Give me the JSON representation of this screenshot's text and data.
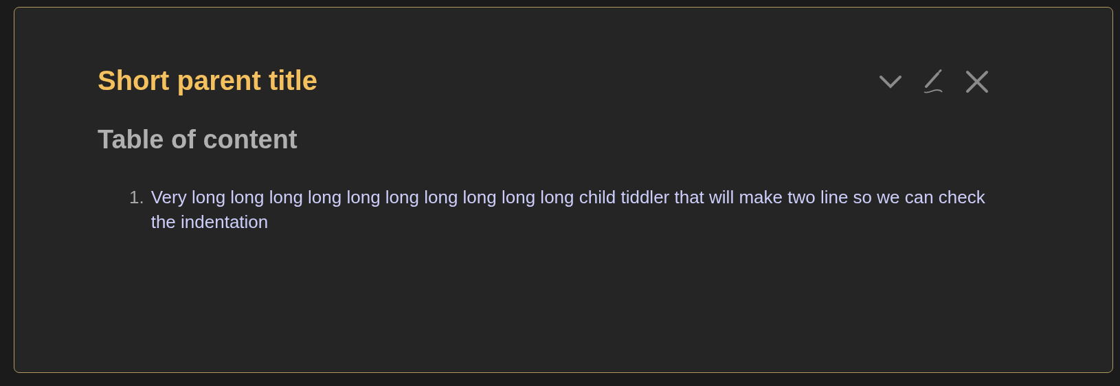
{
  "tiddler": {
    "title": "Short parent title",
    "heading": "Table of content",
    "items": [
      {
        "number": "1.",
        "text": "Very long long long long long long long long long long child tiddler that will make two line so we can check the indentation"
      }
    ]
  }
}
